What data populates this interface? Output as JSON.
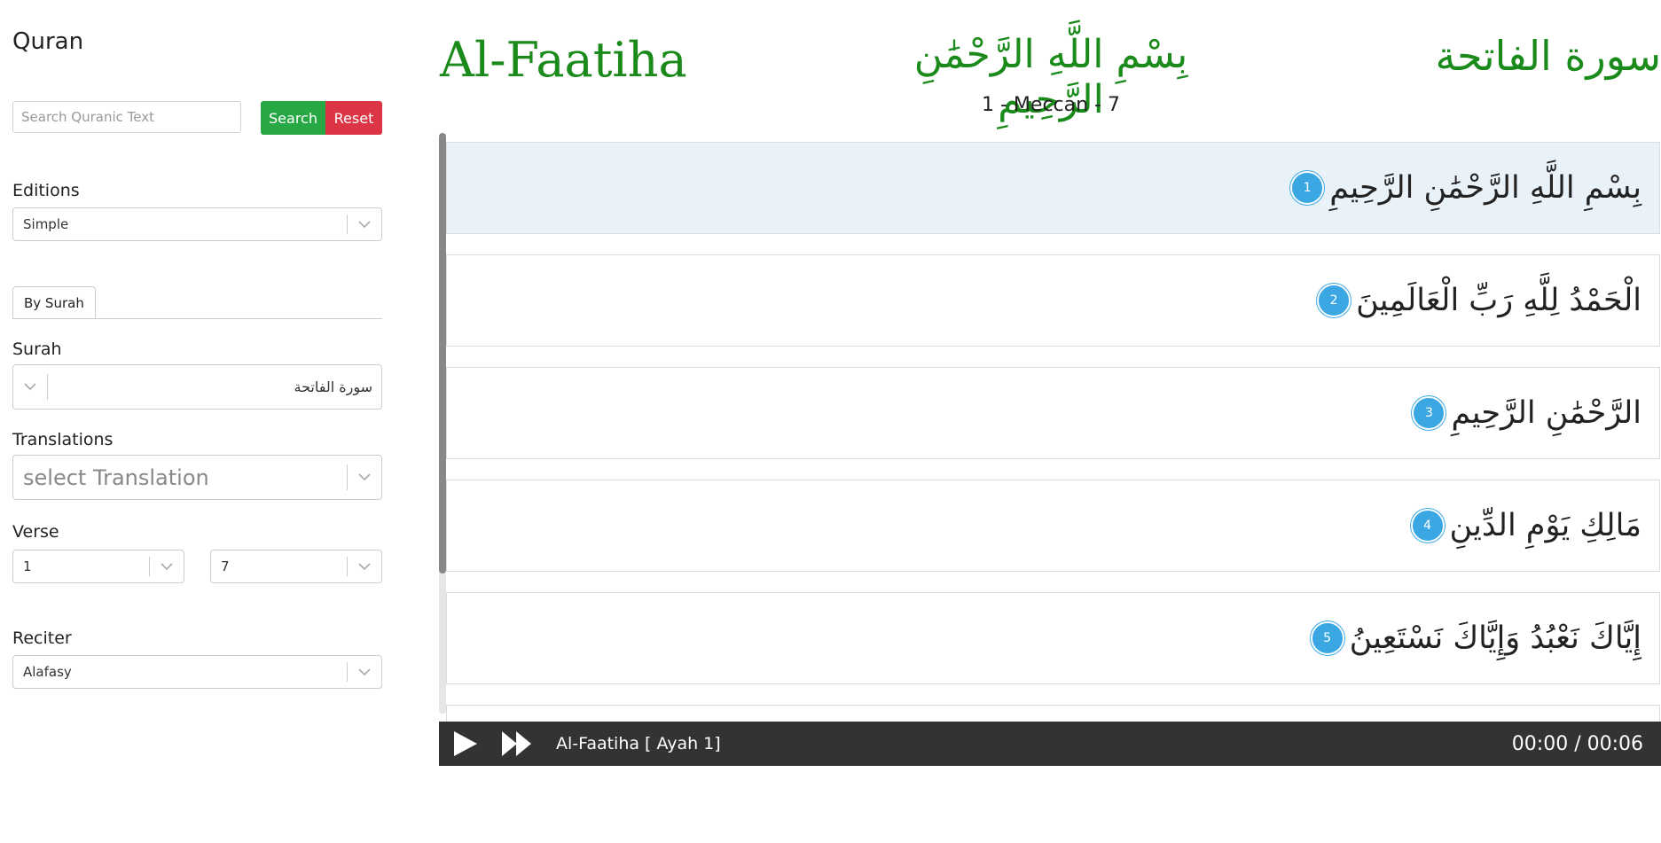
{
  "app": {
    "title": "Quran"
  },
  "search": {
    "placeholder": "Search Quranic Text",
    "value": "",
    "search_label": "Search",
    "reset_label": "Reset"
  },
  "editions": {
    "label": "Editions",
    "selected": "Simple"
  },
  "tabs": [
    {
      "label": "By Surah",
      "active": true
    }
  ],
  "surah": {
    "label": "Surah",
    "selected": "سورة الفاتحة"
  },
  "translations": {
    "label": "Translations",
    "placeholder": "select Translation"
  },
  "verse": {
    "label": "Verse",
    "from": "1",
    "to": "7"
  },
  "reciter": {
    "label": "Reciter",
    "selected": "Alafasy"
  },
  "header": {
    "name_en": "Al-Faatiha",
    "basmala": "بِسْمِ اللَّهِ الرَّحْمَٰنِ الرَّحِيمِ",
    "name_ar": "سورة الفاتحة",
    "subtitle": "1 - Meccan - 7"
  },
  "verses": [
    {
      "number": "1",
      "text": "بِسْمِ اللَّهِ الرَّحْمَٰنِ الرَّحِيمِ",
      "active": true
    },
    {
      "number": "2",
      "text": "الْحَمْدُ لِلَّهِ رَبِّ الْعَالَمِينَ",
      "active": false
    },
    {
      "number": "3",
      "text": "الرَّحْمَٰنِ الرَّحِيمِ",
      "active": false
    },
    {
      "number": "4",
      "text": "مَالِكِ يَوْمِ الدِّينِ",
      "active": false
    },
    {
      "number": "5",
      "text": "إِيَّاكَ نَعْبُدُ وَإِيَّاكَ نَسْتَعِينُ",
      "active": false
    }
  ],
  "player": {
    "track": "Al-Faatiha [ Ayah 1]",
    "time": "00:00 / 00:06"
  },
  "colors": {
    "header_green": "#1a8a1a",
    "search_green": "#28a745",
    "reset_red": "#dc3545",
    "verse_badge": "#3aa7e3",
    "player_bg": "#333333"
  }
}
